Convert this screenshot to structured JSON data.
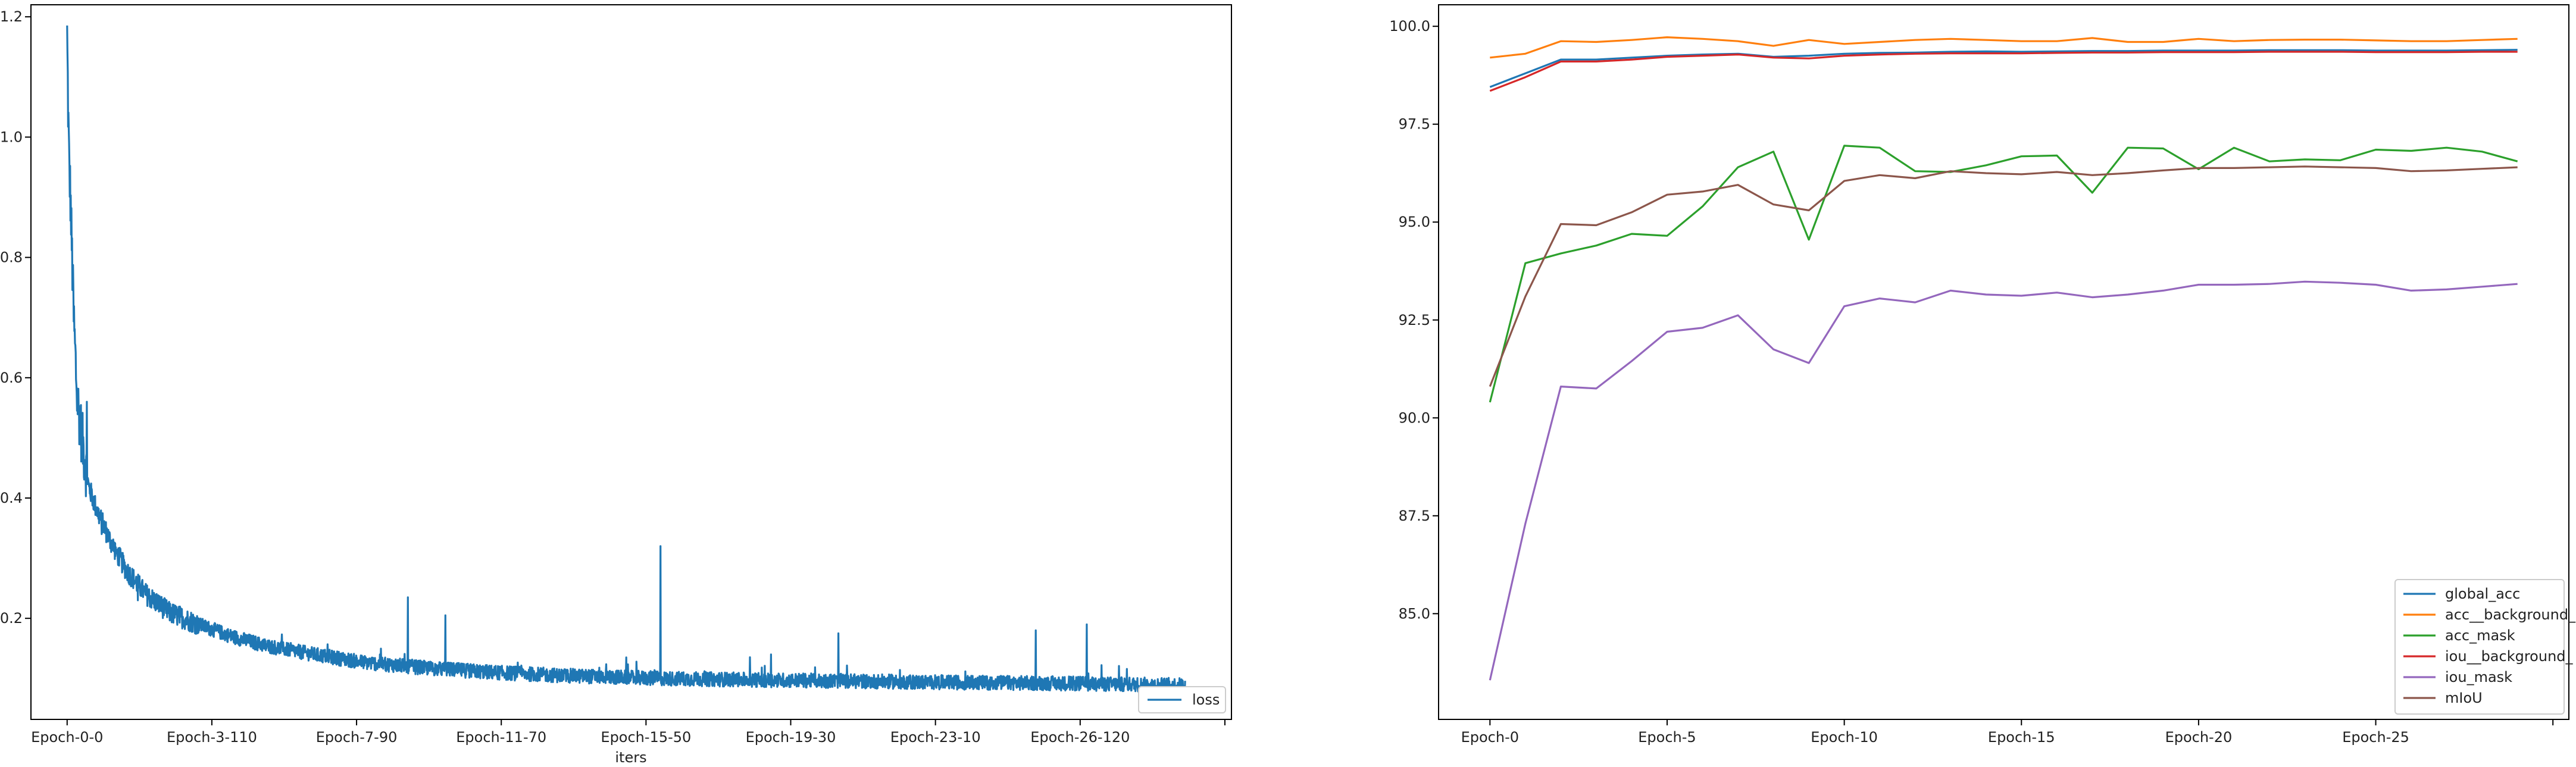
{
  "chart_data": [
    {
      "type": "line",
      "xlabel": "iters",
      "ylabel": "",
      "title": "",
      "x_tick_labels": [
        "Epoch-0-0",
        "Epoch-3-110",
        "Epoch-7-90",
        "Epoch-11-70",
        "Epoch-15-50",
        "Epoch-19-30",
        "Epoch-23-10",
        "Epoch-26-120"
      ],
      "x_tick_index": [
        0,
        440,
        880,
        1320,
        1760,
        2200,
        2640,
        3080
      ],
      "xlim": [
        -110,
        3540
      ],
      "y_ticks": [
        "0.2",
        "0.4",
        "0.6",
        "0.8",
        "1.0",
        "1.2"
      ],
      "ylim": [
        0.032,
        1.22
      ],
      "legend": {
        "entries": [
          "loss"
        ],
        "position": "lower right"
      },
      "series": [
        {
          "name": "loss",
          "color": "#1f77b4",
          "keypoints": [
            [
              0,
              1.17
            ],
            [
              3,
              1.05
            ],
            [
              6,
              0.96
            ],
            [
              10,
              0.9
            ],
            [
              15,
              0.8
            ],
            [
              20,
              0.7
            ],
            [
              30,
              0.57
            ],
            [
              45,
              0.5
            ],
            [
              65,
              0.42
            ],
            [
              90,
              0.38
            ],
            [
              130,
              0.33
            ],
            [
              180,
              0.28
            ],
            [
              240,
              0.24
            ],
            [
              310,
              0.21
            ],
            [
              400,
              0.19
            ],
            [
              500,
              0.17
            ],
            [
              600,
              0.155
            ],
            [
              750,
              0.14
            ],
            [
              900,
              0.127
            ],
            [
              1100,
              0.117
            ],
            [
              1300,
              0.11
            ],
            [
              1500,
              0.105
            ],
            [
              1800,
              0.1
            ],
            [
              2200,
              0.097
            ],
            [
              2600,
              0.094
            ],
            [
              3000,
              0.092
            ],
            [
              3395,
              0.089
            ]
          ],
          "spikes": [
            [
              60,
              0.56
            ],
            [
              105,
              0.34
            ],
            [
              150,
              0.31
            ],
            [
              215,
              0.23
            ],
            [
              1036,
              0.235
            ],
            [
              1150,
              0.205
            ],
            [
              1700,
              0.135
            ],
            [
              1804,
              0.32
            ],
            [
              2140,
              0.14
            ],
            [
              2345,
              0.175
            ],
            [
              2945,
              0.18
            ],
            [
              3100,
              0.19
            ]
          ],
          "n_points": 3400
        }
      ]
    },
    {
      "type": "line",
      "xlabel": "",
      "ylabel": "",
      "title": "",
      "x": [
        0,
        1,
        2,
        3,
        4,
        5,
        6,
        7,
        8,
        9,
        10,
        11,
        12,
        13,
        14,
        15,
        16,
        17,
        18,
        19,
        20,
        21,
        22,
        23,
        24,
        25,
        26,
        27,
        28,
        29
      ],
      "x_tick_labels": [
        "Epoch-0",
        "Epoch-5",
        "Epoch-10",
        "Epoch-15",
        "Epoch-20",
        "Epoch-25"
      ],
      "x_tick_values": [
        0,
        5,
        10,
        15,
        20,
        25
      ],
      "xlim": [
        -1.45,
        30.45
      ],
      "y_ticks": [
        "85.0",
        "87.5",
        "90.0",
        "92.5",
        "95.0",
        "97.5",
        "100.0"
      ],
      "y_tick_values": [
        85.0,
        87.5,
        90.0,
        92.5,
        95.0,
        97.5,
        100.0
      ],
      "ylim": [
        82.3,
        100.55
      ],
      "legend": {
        "entries": [
          "global_acc",
          "acc__background_",
          "acc_mask",
          "iou__background_",
          "iou_mask",
          "mIoU"
        ],
        "position": "lower right"
      },
      "series": [
        {
          "name": "global_acc",
          "color": "#1f77b4",
          "values": [
            98.45,
            98.8,
            99.15,
            99.15,
            99.2,
            99.25,
            99.28,
            99.3,
            99.22,
            99.25,
            99.3,
            99.32,
            99.33,
            99.35,
            99.36,
            99.35,
            99.36,
            99.37,
            99.37,
            99.38,
            99.38,
            99.38,
            99.39,
            99.39,
            99.39,
            99.38,
            99.38,
            99.38,
            99.39,
            99.4
          ]
        },
        {
          "name": "acc__background_",
          "color": "#ff7f0e",
          "values": [
            99.2,
            99.3,
            99.62,
            99.6,
            99.65,
            99.72,
            99.68,
            99.62,
            99.5,
            99.65,
            99.55,
            99.6,
            99.65,
            99.68,
            99.65,
            99.62,
            99.62,
            99.7,
            99.6,
            99.6,
            99.68,
            99.62,
            99.65,
            99.66,
            99.66,
            99.64,
            99.62,
            99.62,
            99.65,
            99.68
          ]
        },
        {
          "name": "acc_mask",
          "color": "#2ca02c",
          "values": [
            90.4,
            93.95,
            94.2,
            94.4,
            94.7,
            94.65,
            95.4,
            96.4,
            96.8,
            94.55,
            96.95,
            96.9,
            96.3,
            96.28,
            96.45,
            96.68,
            96.7,
            95.75,
            96.9,
            96.88,
            96.35,
            96.9,
            96.55,
            96.6,
            96.58,
            96.85,
            96.82,
            96.9,
            96.8,
            96.55
          ]
        },
        {
          "name": "iou__background_",
          "color": "#d62728",
          "values": [
            98.35,
            98.7,
            99.1,
            99.1,
            99.15,
            99.22,
            99.25,
            99.28,
            99.2,
            99.18,
            99.25,
            99.28,
            99.3,
            99.31,
            99.31,
            99.31,
            99.32,
            99.33,
            99.33,
            99.34,
            99.34,
            99.34,
            99.35,
            99.35,
            99.35,
            99.34,
            99.34,
            99.34,
            99.35,
            99.35
          ]
        },
        {
          "name": "iou_mask",
          "color": "#9467bd",
          "values": [
            83.3,
            87.3,
            90.8,
            90.75,
            91.45,
            92.2,
            92.3,
            92.62,
            91.75,
            91.4,
            92.85,
            93.05,
            92.95,
            93.25,
            93.15,
            93.12,
            93.2,
            93.08,
            93.15,
            93.25,
            93.4,
            93.4,
            93.42,
            93.48,
            93.45,
            93.4,
            93.25,
            93.28,
            93.35,
            93.42
          ]
        },
        {
          "name": "mIoU",
          "color": "#8c564b",
          "values": [
            90.8,
            93.1,
            94.95,
            94.92,
            95.25,
            95.7,
            95.78,
            95.95,
            95.45,
            95.3,
            96.05,
            96.2,
            96.12,
            96.3,
            96.25,
            96.22,
            96.28,
            96.2,
            96.25,
            96.32,
            96.38,
            96.38,
            96.4,
            96.42,
            96.4,
            96.38,
            96.3,
            96.32,
            96.36,
            96.4
          ]
        }
      ]
    }
  ]
}
